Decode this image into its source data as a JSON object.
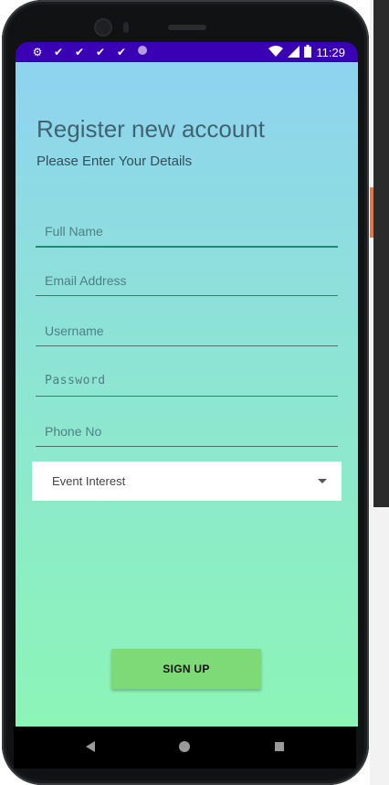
{
  "status_bar": {
    "time": "11:29",
    "icons": [
      "gear-icon",
      "check-icon",
      "check-icon",
      "check-icon",
      "check-icon",
      "circle-icon",
      "wifi-icon",
      "signal-icon",
      "battery-icon"
    ]
  },
  "header": {
    "title": "Register new account",
    "subtitle": "Please Enter Your Details"
  },
  "form": {
    "full_name": {
      "value": "",
      "placeholder": "Full Name"
    },
    "email": {
      "value": "",
      "placeholder": "Email Address"
    },
    "username": {
      "value": "",
      "placeholder": "Username"
    },
    "password": {
      "value": "",
      "placeholder": "Password"
    },
    "phone": {
      "value": "",
      "placeholder": "Phone No"
    },
    "event_interest": {
      "selected": "Event Interest"
    }
  },
  "actions": {
    "signup_label": "SIGN UP"
  },
  "colors": {
    "status_bar": "#3a00b3",
    "gradient_top": "#8fd3f0",
    "gradient_bottom": "#8cf5b7",
    "button": "#7ed977",
    "active_underline": "#1f8777"
  }
}
